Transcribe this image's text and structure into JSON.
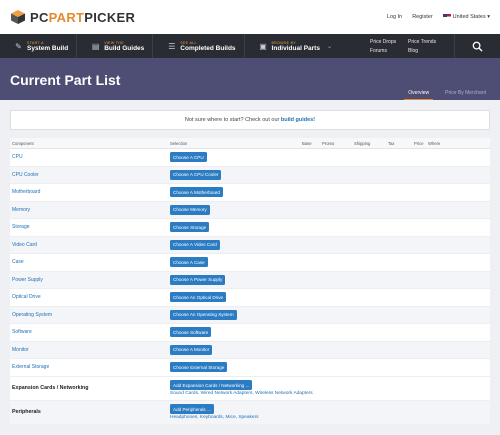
{
  "brand": {
    "pc": "PC",
    "part": "PART",
    "picker": "PICKER"
  },
  "top_links": {
    "login": "Log In",
    "register": "Register",
    "region": "United States"
  },
  "nav": {
    "items": [
      {
        "small": "Start a",
        "big": "System Build",
        "icon": "wrench-icon"
      },
      {
        "small": "View the",
        "big": "Build Guides",
        "icon": "book-icon"
      },
      {
        "small": "See all",
        "big": "Completed Builds",
        "icon": "list-icon"
      },
      {
        "small": "Browse by",
        "big": "Individual Parts",
        "icon": "chip-icon"
      }
    ],
    "links": [
      "Price Drops",
      "Price Trends",
      "Forums",
      "Blog"
    ]
  },
  "header": {
    "title": "Current Part List",
    "tabs": [
      {
        "label": "Overview",
        "active": true
      },
      {
        "label": "Price By Merchant",
        "active": false
      }
    ]
  },
  "notice": {
    "text": "Not sure where to start? Check out our",
    "link": "build guides!"
  },
  "table": {
    "headers": [
      "Component",
      "Selection",
      "Base",
      "Promo",
      "Shipping",
      "Tax",
      "Price",
      "Where"
    ],
    "rows": [
      {
        "component": "CPU",
        "button": "Choose A CPU"
      },
      {
        "component": "CPU Cooler",
        "button": "Choose A CPU Cooler"
      },
      {
        "component": "Motherboard",
        "button": "Choose A Motherboard"
      },
      {
        "component": "Memory",
        "button": "Choose Memory"
      },
      {
        "component": "Storage",
        "button": "Choose Storage"
      },
      {
        "component": "Video Card",
        "button": "Choose A Video Card"
      },
      {
        "component": "Case",
        "button": "Choose A Case"
      },
      {
        "component": "Power Supply",
        "button": "Choose A Power Supply"
      },
      {
        "component": "Optical Drive",
        "button": "Choose An Optical Drive"
      },
      {
        "component": "Operating System",
        "button": "Choose An Operating System"
      },
      {
        "component": "Software",
        "button": "Choose Software"
      },
      {
        "component": "Monitor",
        "button": "Choose A Monitor"
      },
      {
        "component": "External Storage",
        "button": "Choose External Storage"
      }
    ],
    "extra_rows": [
      {
        "component": "Expansion Cards / Networking",
        "button": "Add Expansion Cards / Networking ...",
        "subs": [
          "Sound Cards",
          "Wired Network Adapters",
          "Wireless Network Adapters"
        ]
      },
      {
        "component": "Peripherals",
        "button": "Add Peripherals ...",
        "subs": [
          "Headphones",
          "Keyboards",
          "Mice",
          "Speakers"
        ]
      }
    ]
  },
  "colors": {
    "accent": "#e58b2e",
    "link": "#1f6fb4",
    "button": "#2b7cc2",
    "nav_bg": "#2a2c34",
    "header_bg": "#4e4d74"
  }
}
